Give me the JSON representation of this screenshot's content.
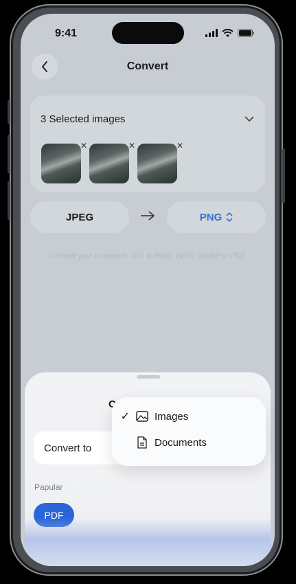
{
  "status_bar": {
    "time": "9:41"
  },
  "header": {
    "title": "Convert",
    "back_icon": "chevron-left-icon"
  },
  "selection_card": {
    "title": "3 Selected images",
    "thumbnail_count": 3
  },
  "formats": {
    "from": "JPEG",
    "to": "PNG"
  },
  "hint": "Convert your images to JEG to PNG, HEIC, WEBP or PDF",
  "sheet": {
    "title_partial": "C",
    "convert_to_label": "Convert to",
    "popular_label": "Papular",
    "chips": [
      "PDF"
    ]
  },
  "menu": {
    "items": [
      {
        "label": "Images",
        "selected": true,
        "icon": "image-icon"
      },
      {
        "label": "Documents",
        "selected": false,
        "icon": "document-icon"
      }
    ]
  },
  "colors": {
    "accent": "#2b66d8",
    "link": "#3b6ed2",
    "overlay_bg": "#c7cdd3"
  }
}
